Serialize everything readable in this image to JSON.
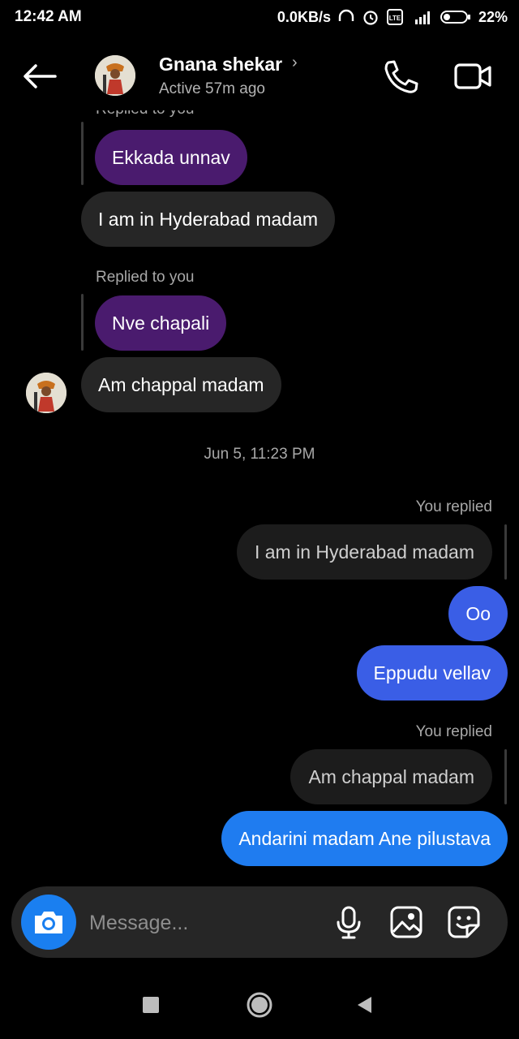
{
  "status_bar": {
    "time": "12:42 AM",
    "net_speed": "0.0KB/s",
    "battery": "22%"
  },
  "header": {
    "name": "Gnana shekar",
    "status": "Active 57m ago"
  },
  "messages": {
    "partial_meta": "Replied to you",
    "quote1": "Ekkada unnav",
    "msg1": "I am in Hyderabad madam",
    "meta2": "Replied to you",
    "quote2": "Nve chapali",
    "msg2": "Am chappal madam",
    "timestamp": "Jun 5, 11:23 PM",
    "you_replied1": "You replied",
    "out_quote1": "I am in Hyderabad madam",
    "out1": "Oo",
    "out2": "Eppudu vellav",
    "you_replied2": "You replied",
    "out_quote2": "Am chappal madam",
    "out3": "Andarini madam Ane pilustava"
  },
  "composer": {
    "placeholder": "Message..."
  },
  "colors": {
    "accent_blue": "#1f7cf0",
    "sent_purple_blue": "#3a5ee6",
    "quote_purple": "#4a1b6e"
  }
}
